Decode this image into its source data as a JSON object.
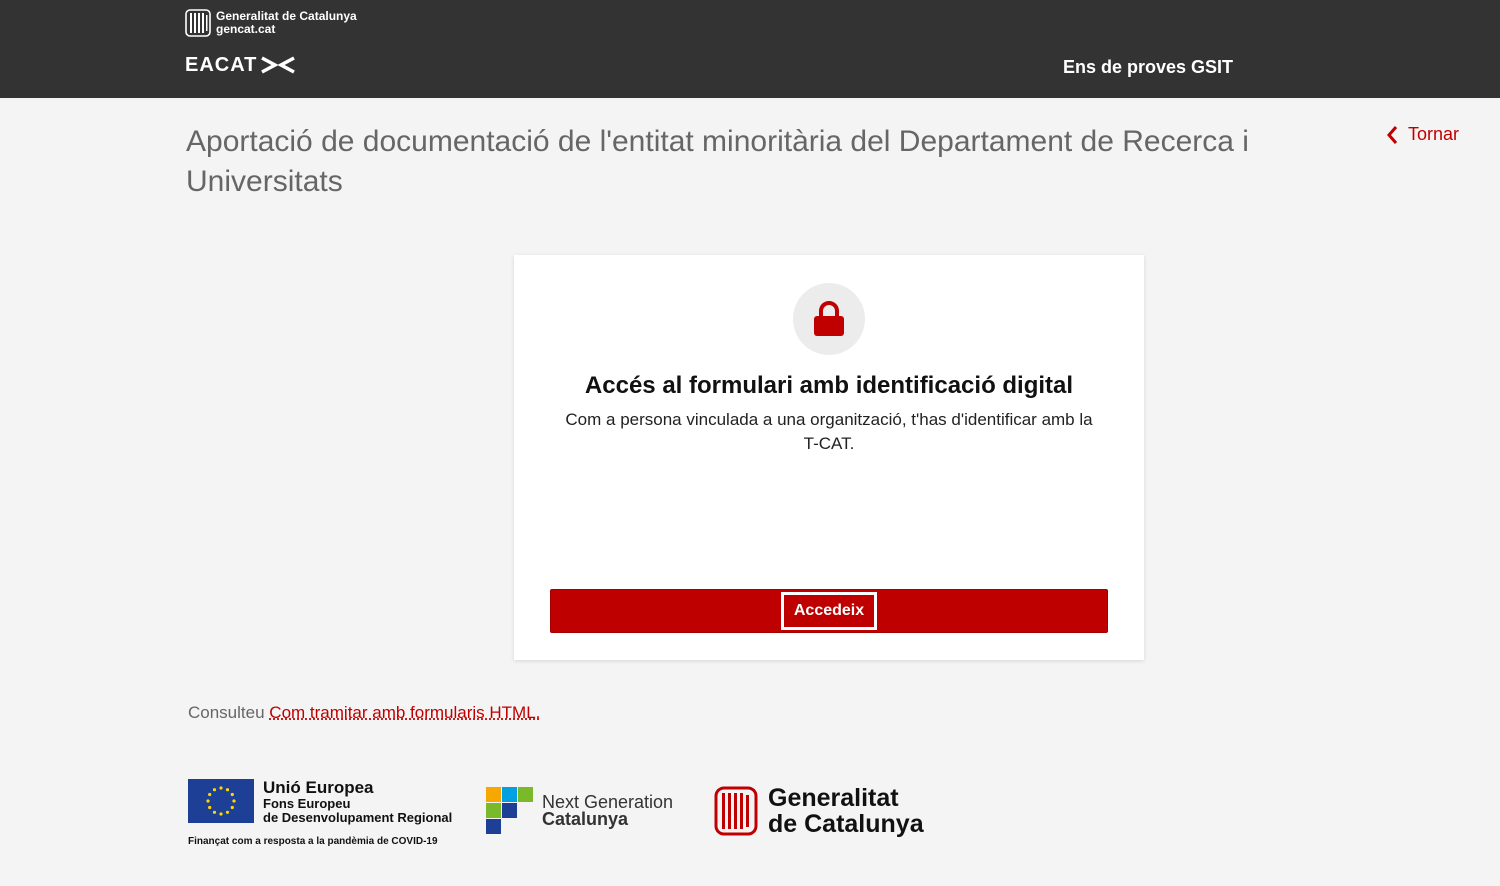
{
  "header": {
    "org_name": "Generalitat de Catalunya",
    "org_site": "gencat.cat",
    "app_name": "EACAT",
    "entity_name": "Ens de proves GSIT"
  },
  "page": {
    "title": "Aportació de documentació de l'entitat minoritària del Departament de Recerca i Universitats",
    "back_label": "Tornar"
  },
  "card": {
    "icon": "lock-icon",
    "title": "Accés al formulari amb identificació digital",
    "description": "Com a persona vinculada a una organització, t'has d'identificar amb la T-CAT.",
    "button_label": "Accedeix"
  },
  "consult": {
    "prefix": "Consulteu",
    "link_text": "Com tramitar amb formularis HTML."
  },
  "footer": {
    "eu": {
      "title": "Unió Europea",
      "line2": "Fons Europeu",
      "line3": "de Desenvolupament Regional",
      "funding": "Finançat com a resposta a la pandèmia de COVID-19"
    },
    "ng": {
      "line1": "Next Generation",
      "line2": "Catalunya"
    },
    "gc": {
      "line1": "Generalitat",
      "line2": "de Catalunya"
    }
  },
  "colors": {
    "header_bg": "#333333",
    "accent": "#bf0000",
    "page_bg": "#f4f4f4"
  }
}
